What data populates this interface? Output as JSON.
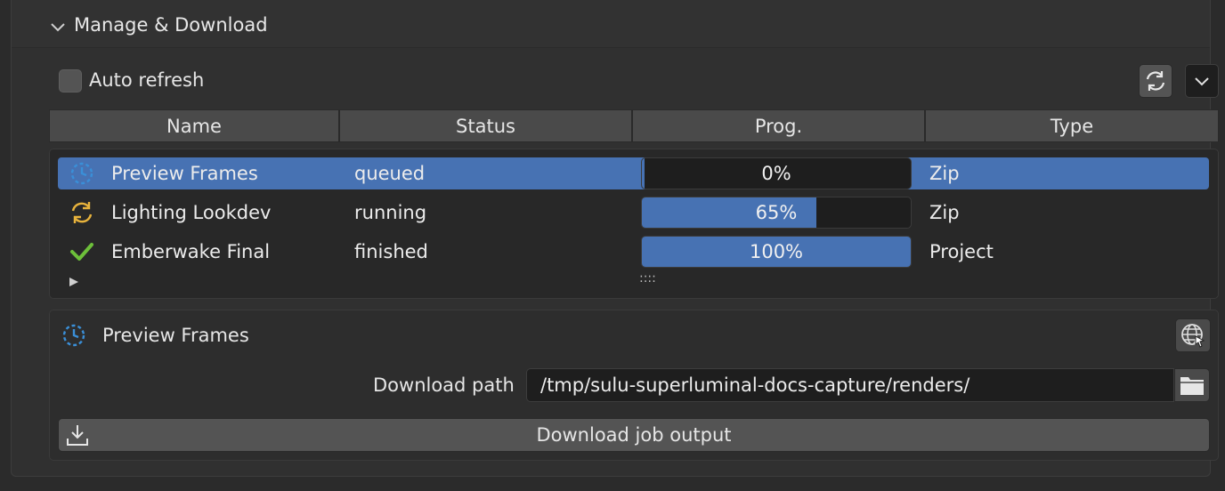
{
  "panel": {
    "title": "Manage & Download"
  },
  "toolbar": {
    "auto_refresh_label": "Auto refresh",
    "auto_refresh_checked": false
  },
  "columns": [
    "Name",
    "Status",
    "Prog.",
    "Type"
  ],
  "jobs": [
    {
      "name": "Preview Frames",
      "status": "queued",
      "progress_percent": 0,
      "progress_label": "0%",
      "type": "Zip",
      "icon": "clock-icon",
      "selected": true
    },
    {
      "name": "Lighting Lookdev",
      "status": "running",
      "progress_percent": 65,
      "progress_label": "65%",
      "type": "Zip",
      "icon": "refresh-icon",
      "selected": false
    },
    {
      "name": "Emberwake Final",
      "status": "finished",
      "progress_percent": 100,
      "progress_label": "100%",
      "type": "Project",
      "icon": "checkmark-icon",
      "selected": false
    }
  ],
  "list_footer": {
    "resize_grip": "::::"
  },
  "detail": {
    "title": "Preview Frames",
    "download_path_label": "Download path",
    "download_path_value": "/tmp/sulu-superluminal-docs-capture/renders/",
    "download_button_label": "Download job output"
  },
  "colors": {
    "accent": "#4772b3",
    "running_icon": "#e8b33c",
    "finished_icon": "#6dbf3a",
    "queued_icon": "#3a8fd8"
  }
}
